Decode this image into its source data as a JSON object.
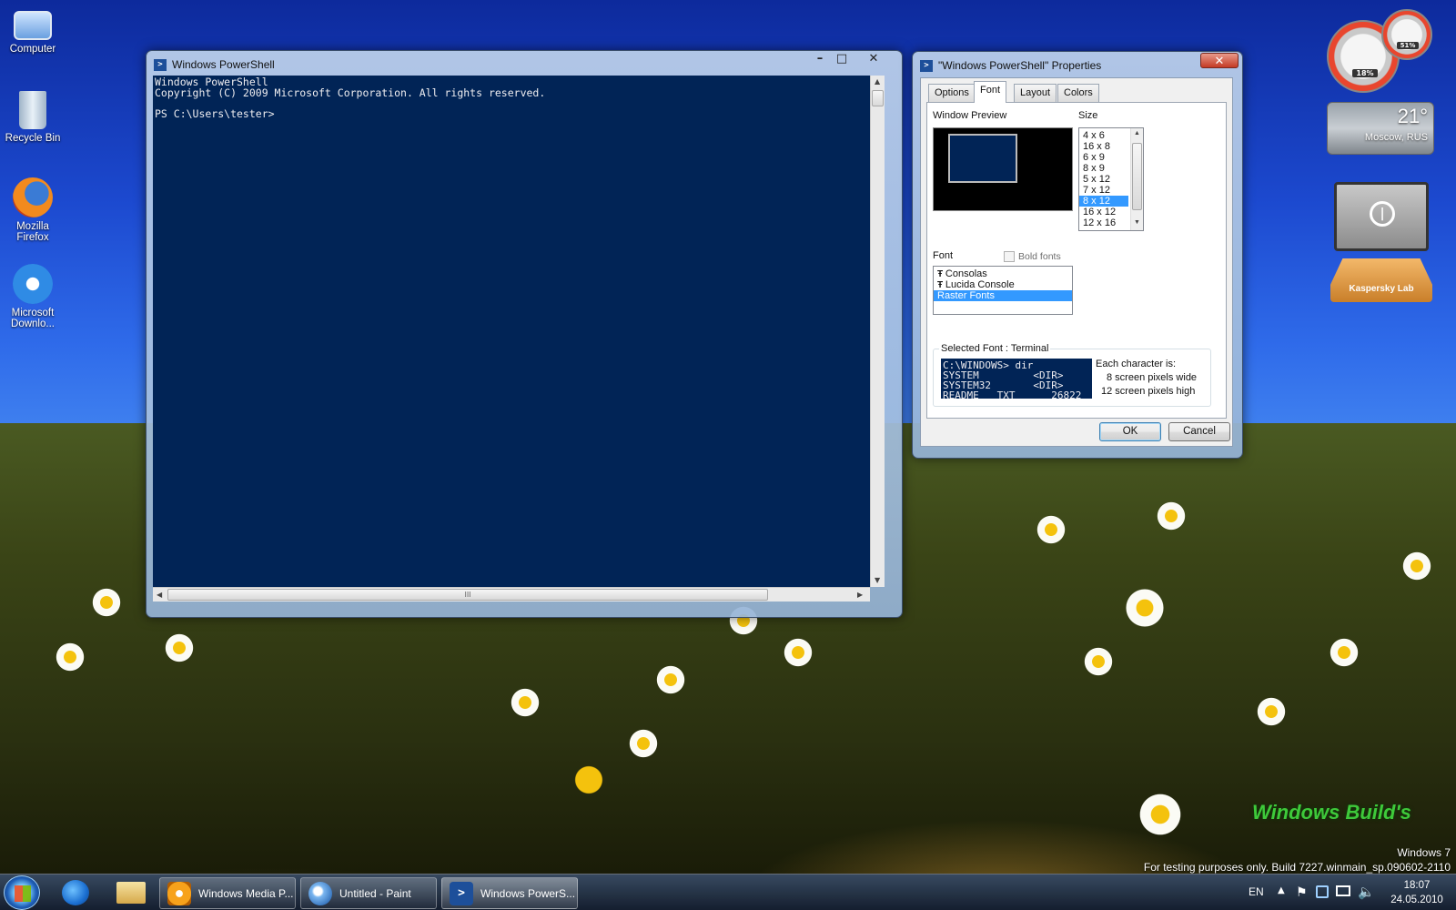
{
  "desktop": {
    "icons": [
      {
        "label": "Computer"
      },
      {
        "label": "Recycle Bin"
      },
      {
        "label": "Mozilla Firefox"
      },
      {
        "label": "Microsoft Downlo..."
      }
    ],
    "branding": "Windows Build's",
    "watermark_line1": "Windows 7",
    "watermark_line2": "For testing purposes only. Build 7227.winmain_sp.090602-2110"
  },
  "powershell_window": {
    "title": "Windows PowerShell",
    "lines": [
      "Windows PowerShell",
      "Copyright (C) 2009 Microsoft Corporation. All rights reserved.",
      "",
      "PS C:\\Users\\tester>"
    ],
    "hscroll_grip": "III"
  },
  "properties_dialog": {
    "title": "\"Windows PowerShell\" Properties",
    "tabs": [
      "Options",
      "Font",
      "Layout",
      "Colors"
    ],
    "active_tab": "Font",
    "window_preview_label": "Window Preview",
    "size_label": "Size",
    "sizes": [
      "4 x 6",
      "16 x 8",
      "6 x 9",
      "8 x 9",
      "5 x 12",
      "7 x 12",
      "8 x 12",
      "16 x 12",
      "12 x 16"
    ],
    "selected_size": "8 x 12",
    "font_label": "Font",
    "bold_fonts_label": "Bold fonts",
    "bold_fonts_checked": false,
    "fonts": [
      "Consolas",
      "Lucida Console",
      "Raster Fonts"
    ],
    "selected_font": "Raster Fonts",
    "selected_font_caption": "Selected Font : Terminal",
    "sample_lines": [
      "C:\\WINDOWS> dir",
      "SYSTEM         <DIR>",
      "SYSTEM32       <DIR>",
      "README   TXT      26822"
    ],
    "each_char_label": "Each character is:",
    "pixels_wide": "8 screen pixels wide",
    "pixels_high": "12 screen pixels high",
    "ok_label": "OK",
    "cancel_label": "Cancel"
  },
  "gadgets": {
    "cpu_percent": "18%",
    "mem_percent": "51%",
    "weather_temp": "21°",
    "weather_city": "Moscow, RUS",
    "kaspersky_label": "Kaspersky Lab"
  },
  "taskbar": {
    "buttons": [
      {
        "label": "Windows Media P..."
      },
      {
        "label": "Untitled - Paint"
      },
      {
        "label": "Windows PowerS..."
      }
    ],
    "language": "EN",
    "time": "18:07",
    "date": "24.05.2010"
  },
  "colors": {
    "console_bg": "#012456",
    "selection": "#3399ff"
  }
}
